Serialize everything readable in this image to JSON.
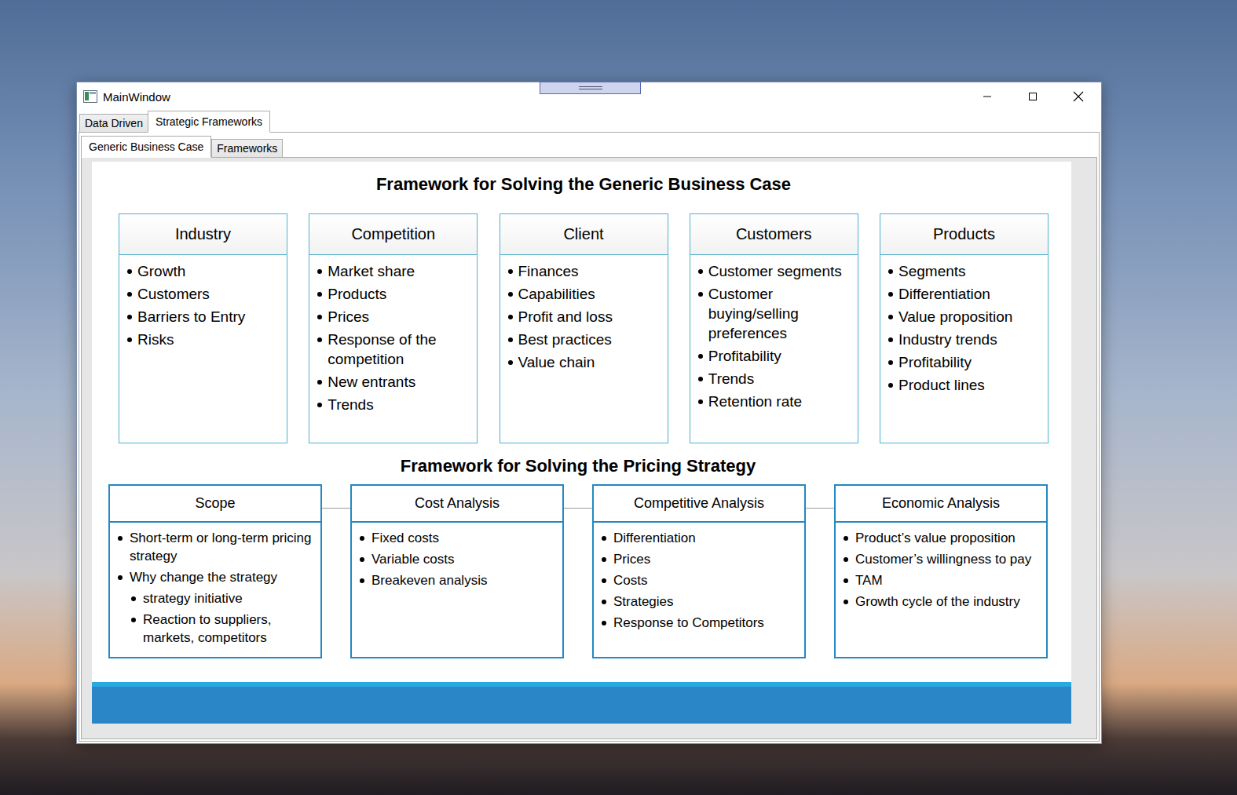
{
  "window": {
    "title": "MainWindow"
  },
  "tabs": [
    {
      "label": "Data Driven",
      "selected": false
    },
    {
      "label": "Strategic Frameworks",
      "selected": true
    }
  ],
  "subtabs": [
    {
      "label": "Generic Business Case",
      "selected": true
    },
    {
      "label": "Frameworks",
      "selected": false
    }
  ],
  "business_case": {
    "title": "Framework for Solving the Generic Business Case",
    "cards": [
      {
        "title": "Industry",
        "items": [
          "Growth",
          "Customers",
          "Barriers to Entry",
          "Risks"
        ]
      },
      {
        "title": "Competition",
        "items": [
          "Market share",
          "Products",
          "Prices",
          "Response of the competition",
          "New entrants",
          "Trends"
        ]
      },
      {
        "title": "Client",
        "items": [
          "Finances",
          "Capabilities",
          "Profit and loss",
          "Best practices",
          "Value chain"
        ]
      },
      {
        "title": "Customers",
        "items": [
          "Customer segments",
          "Customer buying/selling preferences",
          "Profitability",
          "Trends",
          "Retention rate"
        ]
      },
      {
        "title": "Products",
        "items": [
          "Segments",
          "Differentiation",
          "Value proposition",
          "Industry trends",
          "Profitability",
          "Product lines"
        ]
      }
    ]
  },
  "pricing": {
    "title": "Framework for Solving the Pricing Strategy",
    "cards": [
      {
        "title": "Scope",
        "items": [
          {
            "text": "Short-term or long-term pricing strategy",
            "kind": "bullet"
          },
          {
            "text": "Why change the strategy",
            "kind": "bullet"
          },
          {
            "text": "strategy initiative",
            "kind": "sub"
          },
          {
            "text": "Reaction to suppliers, markets, competitors",
            "kind": "sub"
          }
        ]
      },
      {
        "title": "Cost Analysis",
        "items": [
          {
            "text": "Fixed costs",
            "kind": "bullet"
          },
          {
            "text": "Variable costs",
            "kind": "bullet"
          },
          {
            "text": "Breakeven analysis",
            "kind": "bullet"
          }
        ]
      },
      {
        "title": "Competitive Analysis",
        "items": [
          {
            "text": "Differentiation",
            "kind": "bullet"
          },
          {
            "text": "Prices",
            "kind": "bullet"
          },
          {
            "text": "Costs",
            "kind": "bullet"
          },
          {
            "text": "Strategies",
            "kind": "bullet"
          },
          {
            "text": "Response to Competitors",
            "kind": "bullet"
          }
        ]
      },
      {
        "title": "Economic Analysis",
        "items": [
          {
            "text": "Product’s value proposition",
            "kind": "bullet"
          },
          {
            "text": "Customer’s willingness to pay",
            "kind": "bullet"
          },
          {
            "text": "TAM",
            "kind": "bullet"
          },
          {
            "text": "Growth cycle of the industry",
            "kind": "bullet"
          }
        ]
      }
    ]
  }
}
